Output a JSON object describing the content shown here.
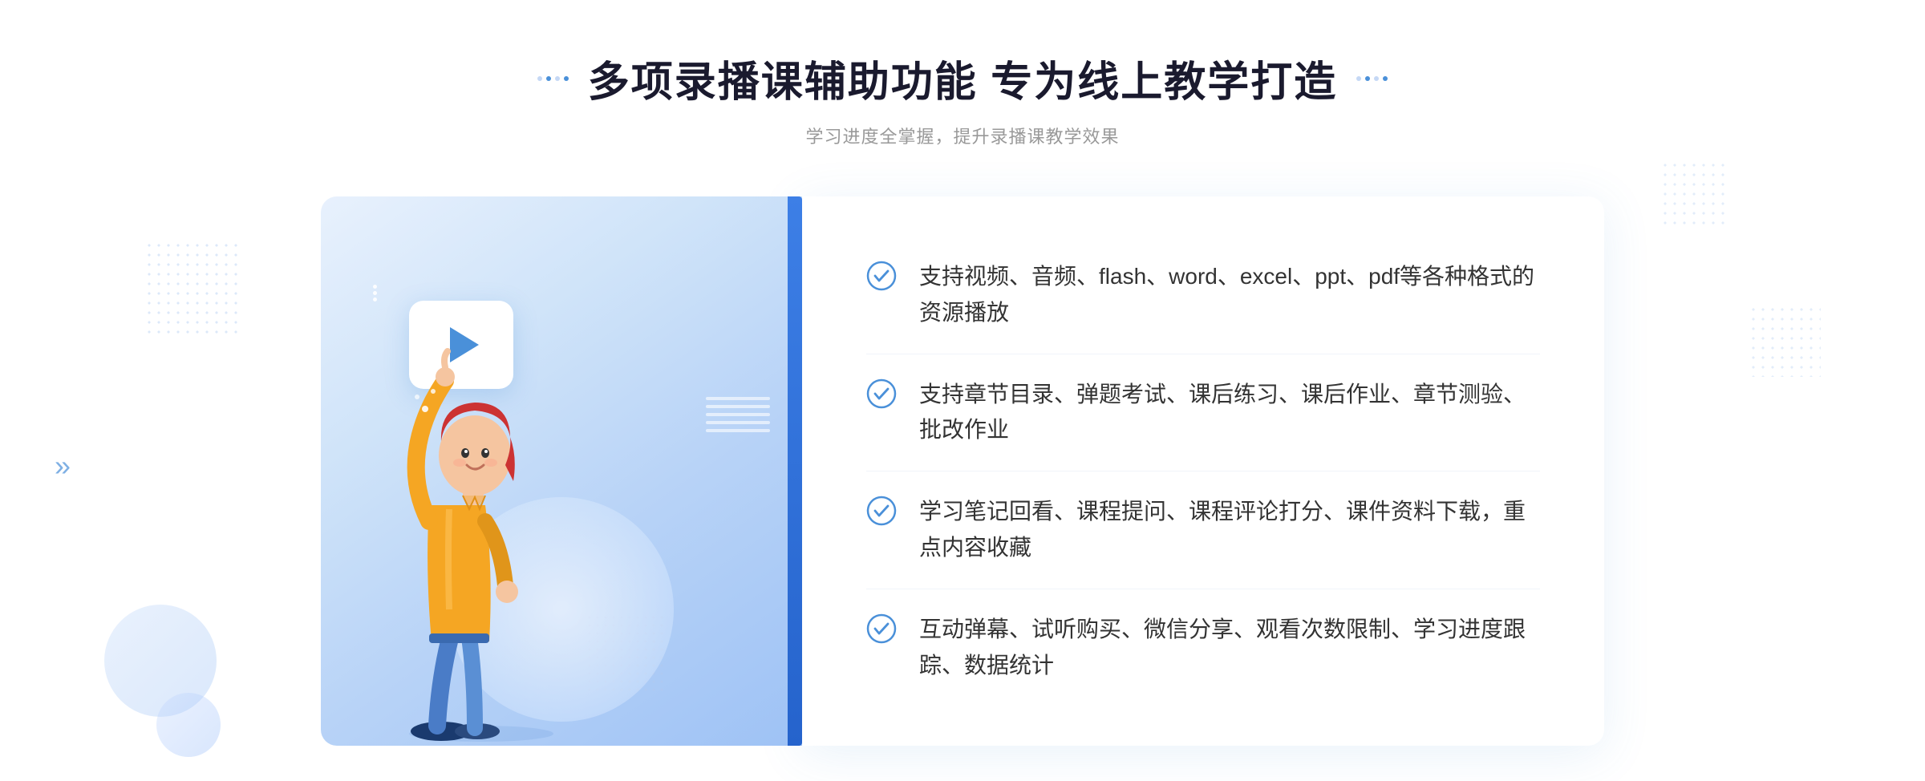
{
  "page": {
    "title": "多项录播课辅助功能 专为线上教学打造",
    "subtitle": "学习进度全掌握，提升录播课教学效果",
    "title_dots": [
      "◆",
      "◆",
      "◆",
      "◆"
    ]
  },
  "features": [
    {
      "id": 1,
      "text": "支持视频、音频、flash、word、excel、ppt、pdf等各种格式的资源播放"
    },
    {
      "id": 2,
      "text": "支持章节目录、弹题考试、课后练习、课后作业、章节测验、批改作业"
    },
    {
      "id": 3,
      "text": "学习笔记回看、课程提问、课程评论打分、课件资料下载，重点内容收藏"
    },
    {
      "id": 4,
      "text": "互动弹幕、试听购买、微信分享、观看次数限制、学习进度跟踪、数据统计"
    }
  ],
  "colors": {
    "primary": "#4a90d9",
    "title": "#1a1a2e",
    "text": "#333333",
    "subtitle": "#999999",
    "check": "#4a90d9",
    "panel_bg": "#ffffff"
  },
  "decorations": {
    "chevron": "»",
    "play": "▶"
  }
}
